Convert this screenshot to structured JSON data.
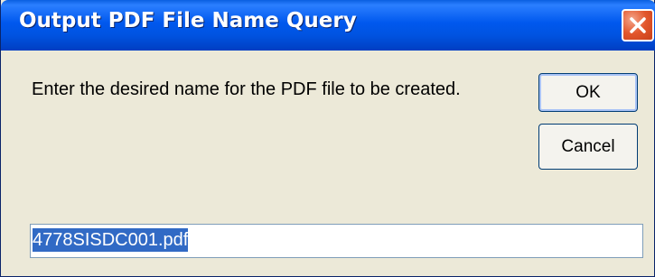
{
  "window": {
    "title": "Output PDF File Name Query",
    "close_icon": "close-icon"
  },
  "prompt": {
    "text": "Enter the desired name for the PDF file to be created."
  },
  "buttons": {
    "ok_label": "OK",
    "cancel_label": "Cancel"
  },
  "input": {
    "value": "4778SISDC001.pdf",
    "selected": true
  },
  "colors": {
    "titlebar": "#0058ee",
    "dialog_bg": "#ece9d8",
    "close_button": "#e2562c",
    "selection": "#316ac5"
  }
}
